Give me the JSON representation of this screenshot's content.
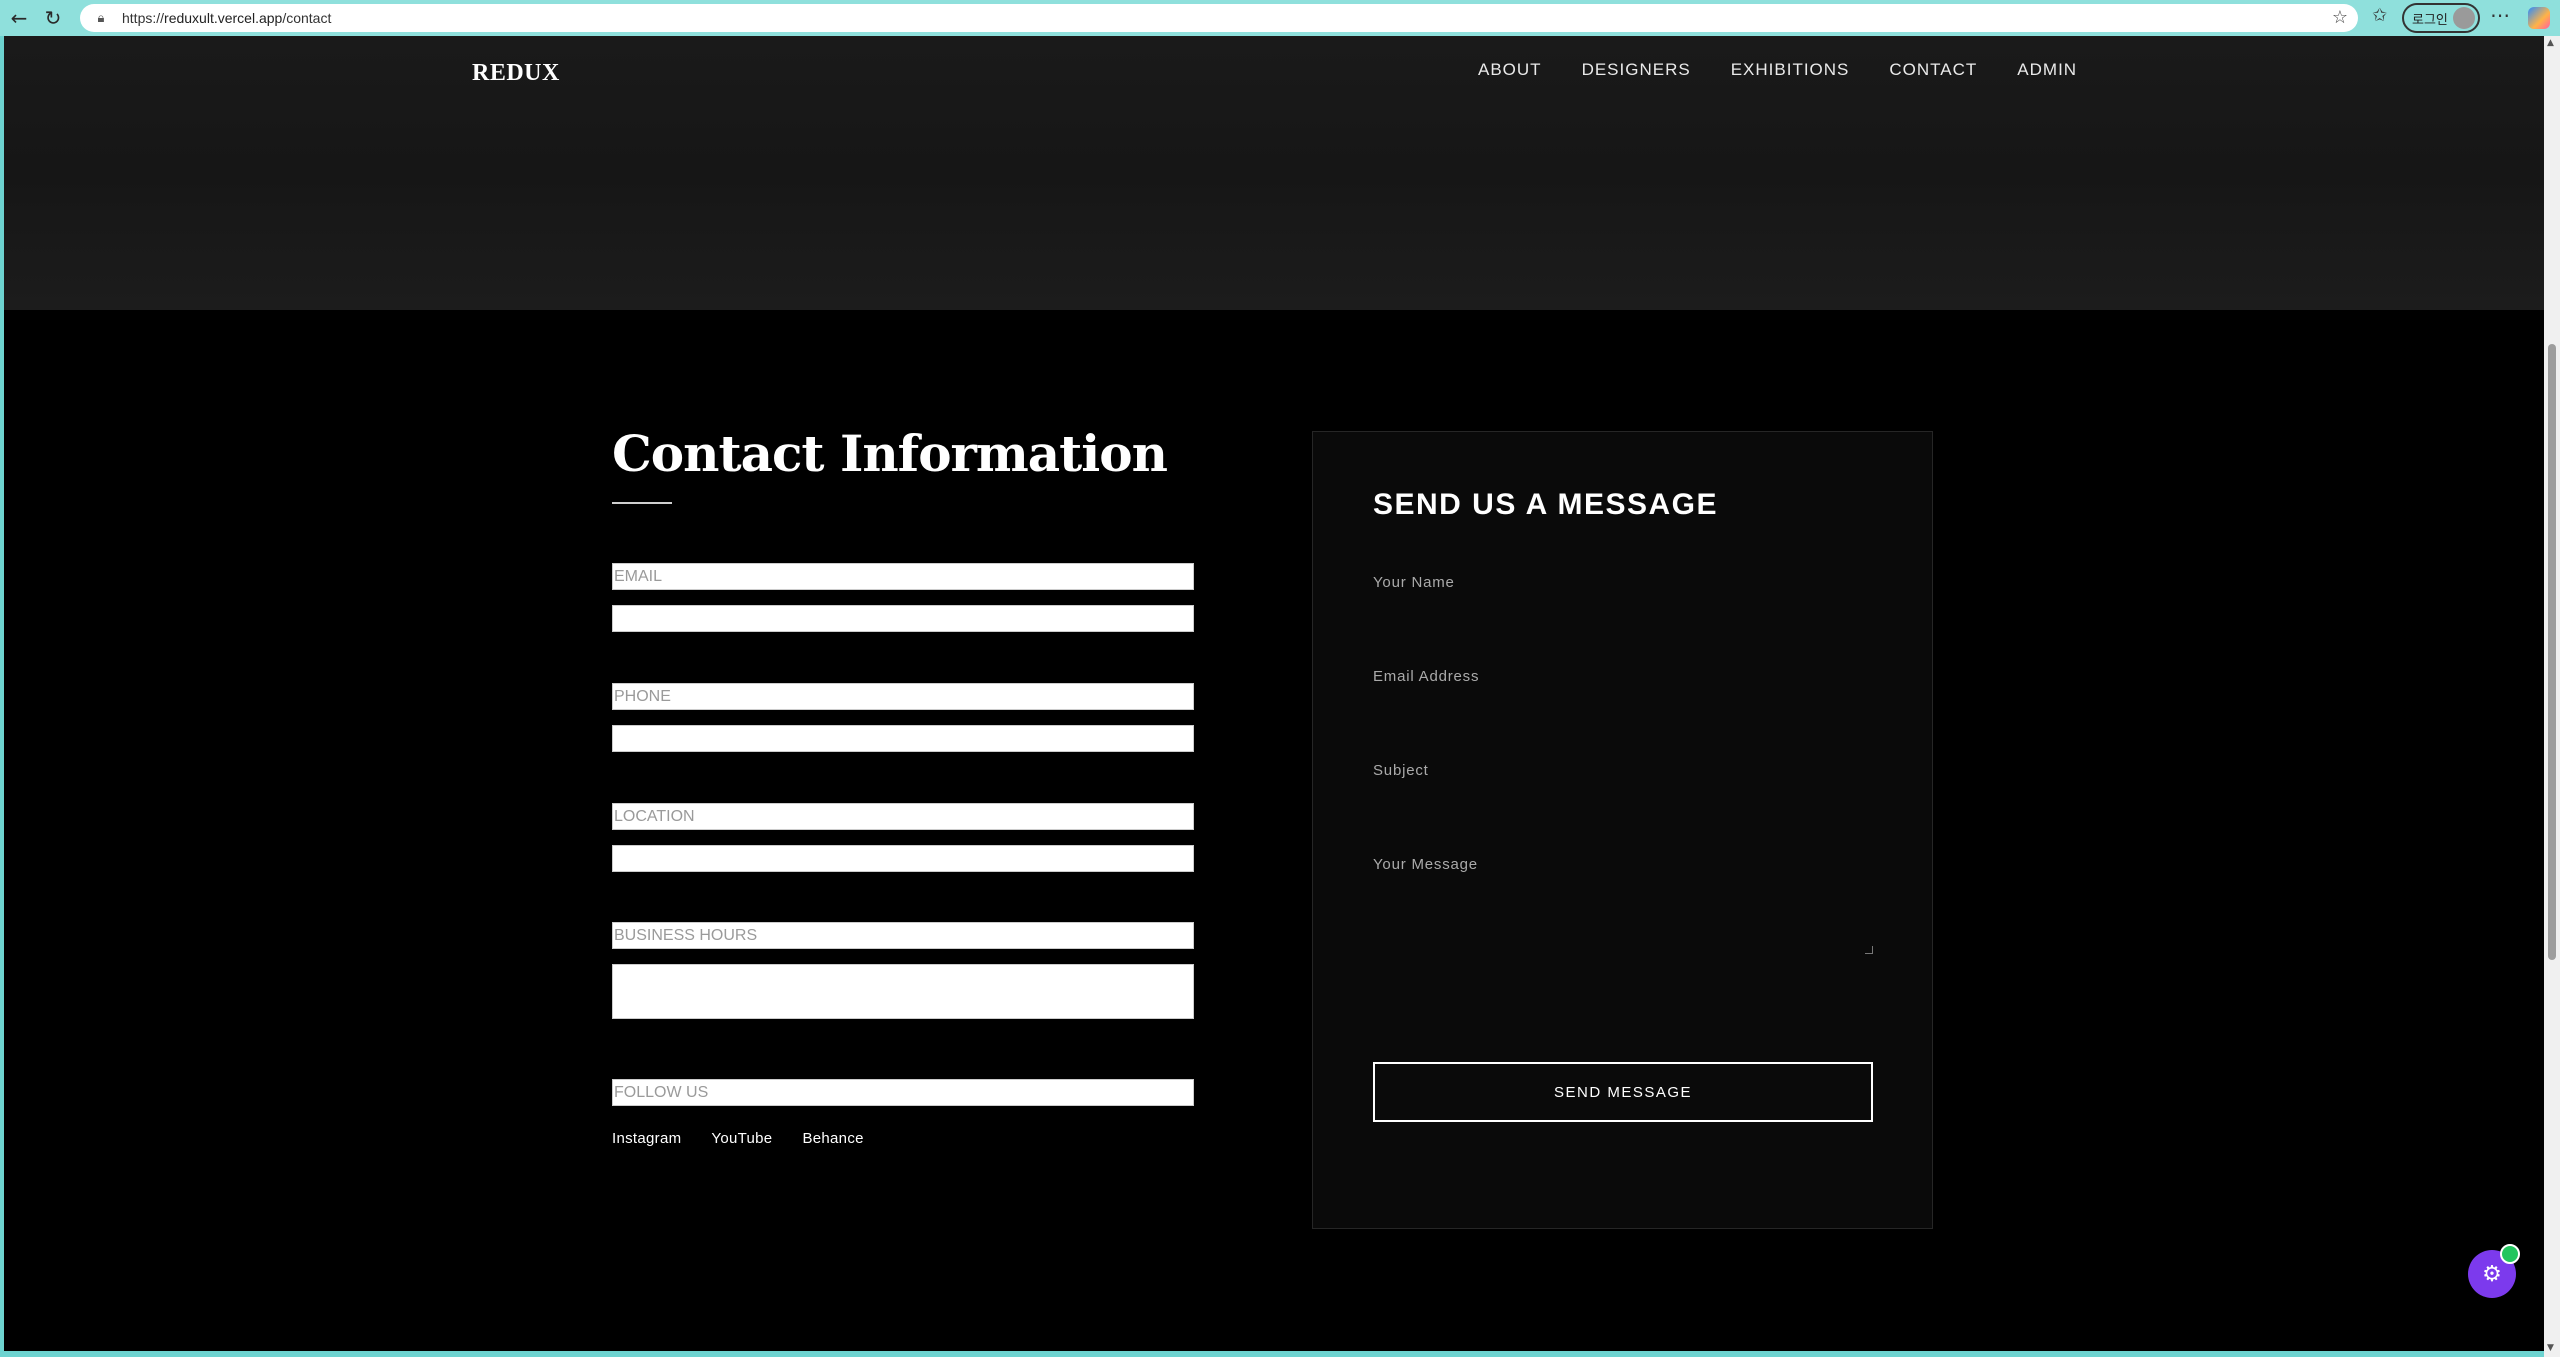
{
  "browser": {
    "url_prefix": "https://",
    "url_host": "reduxult.vercel.app",
    "url_path": "/contact",
    "login_label": "로그인",
    "icons": [
      "back-arrow-icon",
      "reload-icon",
      "lock-icon",
      "star-icon",
      "favorites-icon",
      "more-icon",
      "copilot-icon"
    ]
  },
  "site": {
    "brand": "REDUX",
    "nav": [
      "ABOUT",
      "DESIGNERS",
      "EXHIBITIONS",
      "CONTACT",
      "ADMIN"
    ]
  },
  "contact_info": {
    "heading": "Contact Information",
    "fields": [
      {
        "label": "EMAIL",
        "value": ""
      },
      {
        "label": "PHONE",
        "value": ""
      },
      {
        "label": "LOCATION",
        "value": ""
      },
      {
        "label": "BUSINESS HOURS",
        "value": ""
      }
    ],
    "follow_label": "FOLLOW US",
    "socials": [
      "Instagram",
      "YouTube",
      "Behance"
    ]
  },
  "message_form": {
    "title": "SEND US A MESSAGE",
    "name_placeholder": "Your Name",
    "email_placeholder": "Email Address",
    "subject_placeholder": "Subject",
    "message_placeholder": "Your Message",
    "submit_label": "SEND MESSAGE"
  },
  "colors": {
    "page_background": "#000000",
    "hero_background": "#1a1a1a",
    "fab_color": "#7c3aed",
    "fab_badge": "#22c55e"
  },
  "fab_icon": "settings-gear-icon"
}
